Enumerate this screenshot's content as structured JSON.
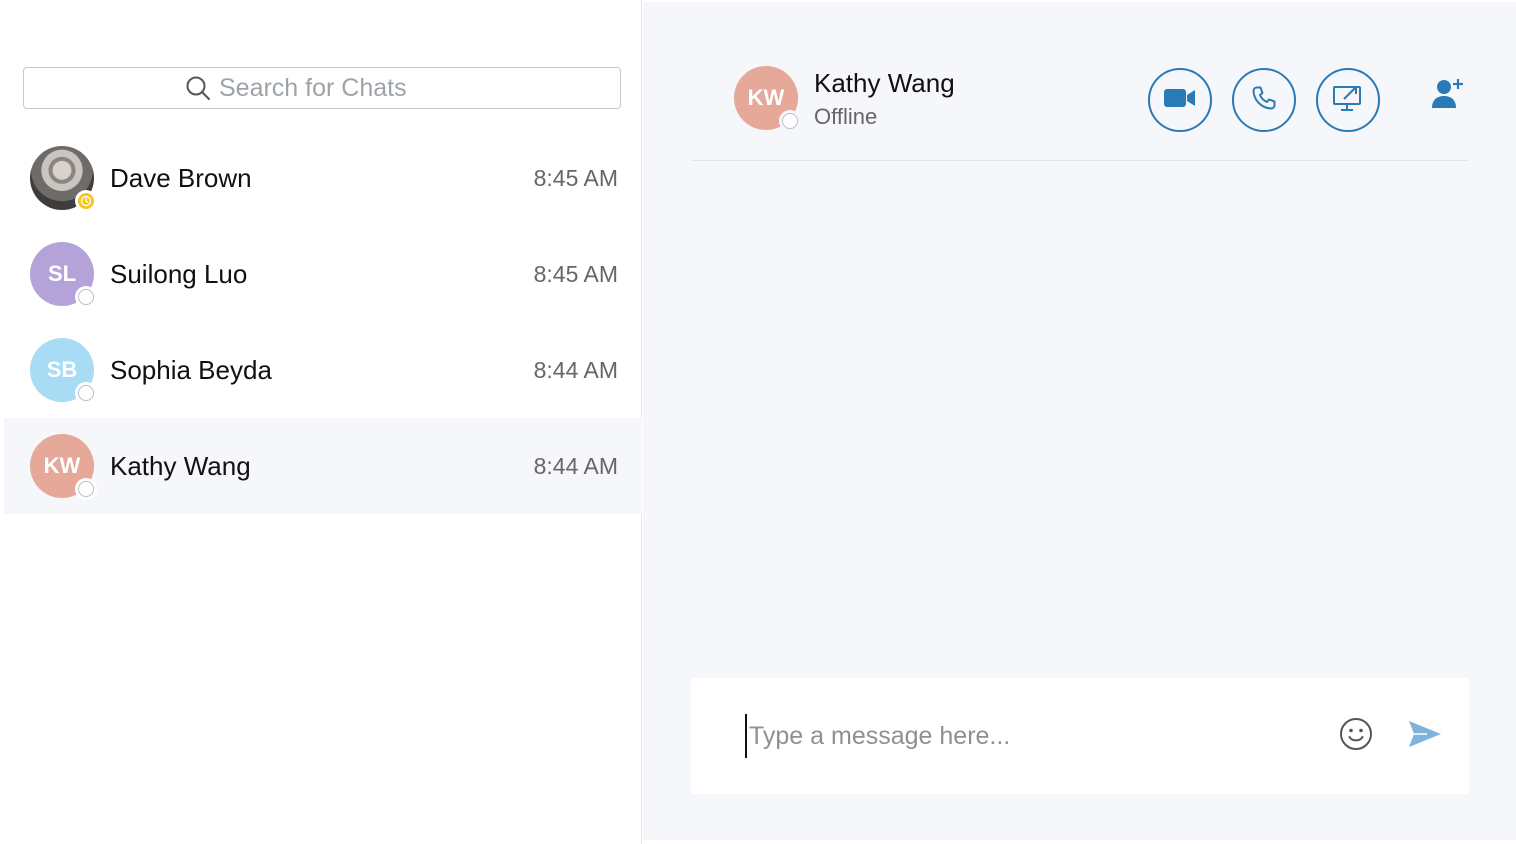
{
  "sidebar": {
    "search": {
      "placeholder": "Search for Chats",
      "value": ""
    },
    "chats": [
      {
        "name": "Dave Brown",
        "time": "8:45 AM",
        "initials": "",
        "avatar_color": "#5d5a57",
        "status": "away",
        "selected": false
      },
      {
        "name": "Suilong Luo",
        "time": "8:45 AM",
        "initials": "SL",
        "avatar_color": "#b4a3d8",
        "status": "offline",
        "selected": false
      },
      {
        "name": "Sophia Beyda",
        "time": "8:44 AM",
        "initials": "SB",
        "avatar_color": "#a8dcf5",
        "status": "offline",
        "selected": false
      },
      {
        "name": "Kathy Wang",
        "time": "8:44 AM",
        "initials": "KW",
        "avatar_color": "#e6a898",
        "status": "offline",
        "selected": true
      }
    ]
  },
  "conversation": {
    "contact": {
      "initials": "KW",
      "name": "Kathy Wang",
      "status": "Offline",
      "avatar_color": "#e6a898"
    },
    "actions": [
      "video-call-icon",
      "audio-call-icon",
      "screen-share-icon",
      "add-contact-icon"
    ],
    "composer": {
      "placeholder": "Type a message here...",
      "value": ""
    }
  },
  "colors": {
    "accent": "#2a7ab8",
    "send": "#7fb3dc",
    "away": "#f3c623",
    "panel_bg": "#f5f7fa"
  }
}
